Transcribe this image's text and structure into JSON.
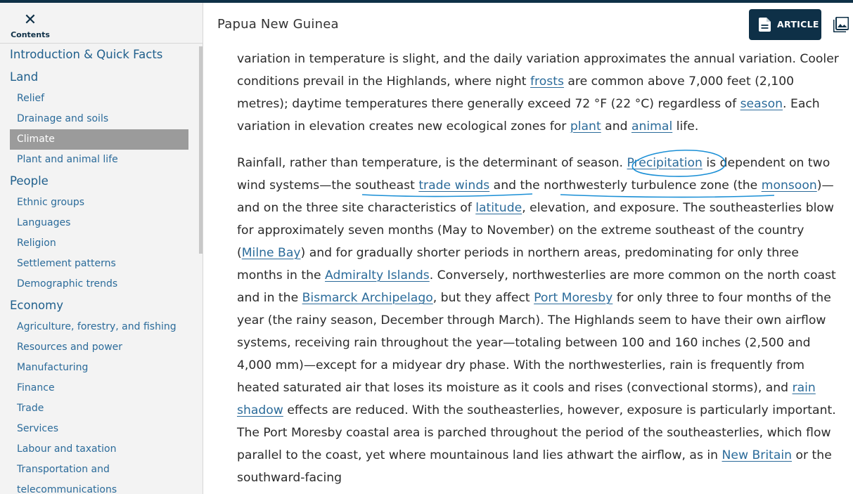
{
  "colors": {
    "brand_navy": "#0e3047",
    "link": "#2b6b9a",
    "active_bg": "#9b9b9b",
    "annotation": "#1a8fd6"
  },
  "sidebar": {
    "close_label": "Contents",
    "close_icon": "close-icon",
    "items": [
      {
        "type": "section",
        "label": "Introduction & Quick Facts"
      },
      {
        "type": "section",
        "label": "Land"
      },
      {
        "type": "sub",
        "label": "Relief"
      },
      {
        "type": "sub",
        "label": "Drainage and soils"
      },
      {
        "type": "sub",
        "label": "Climate",
        "active": true
      },
      {
        "type": "sub",
        "label": "Plant and animal life"
      },
      {
        "type": "section",
        "label": "People"
      },
      {
        "type": "sub",
        "label": "Ethnic groups"
      },
      {
        "type": "sub",
        "label": "Languages"
      },
      {
        "type": "sub",
        "label": "Religion"
      },
      {
        "type": "sub",
        "label": "Settlement patterns"
      },
      {
        "type": "sub",
        "label": "Demographic trends"
      },
      {
        "type": "section",
        "label": "Economy"
      },
      {
        "type": "sub",
        "label": "Agriculture, forestry, and fishing"
      },
      {
        "type": "sub",
        "label": "Resources and power"
      },
      {
        "type": "sub",
        "label": "Manufacturing"
      },
      {
        "type": "sub",
        "label": "Finance"
      },
      {
        "type": "sub",
        "label": "Trade"
      },
      {
        "type": "sub",
        "label": "Services"
      },
      {
        "type": "sub",
        "label": "Labour and taxation"
      },
      {
        "type": "sub",
        "label": "Transportation and telecommunications"
      }
    ]
  },
  "header": {
    "title": "Papua New Guinea",
    "article_label": "ARTICLE",
    "article_icon": "document-icon",
    "media_icon": "image-gallery-icon"
  },
  "article": {
    "p1": [
      {
        "t": "variation in temperature is slight, and the daily variation approximates the annual variation. Cooler conditions prevail in the Highlands, where night "
      },
      {
        "t": "frosts",
        "link": true
      },
      {
        "t": " are common above 7,000 feet (2,100 metres); daytime temperatures there generally exceed 72 °F (22 °C) regardless of "
      },
      {
        "t": "season",
        "link": true
      },
      {
        "t": ". Each variation in elevation creates new ecological zones for "
      },
      {
        "t": "plant",
        "link": true
      },
      {
        "t": " and "
      },
      {
        "t": "animal",
        "link": true
      },
      {
        "t": " life."
      }
    ],
    "p2": [
      {
        "t": "Rainfall, rather than temperature, is the determinant of season. "
      },
      {
        "t": "Precipitation",
        "link": true
      },
      {
        "t": " is dependent on two wind systems—the southeast "
      },
      {
        "t": "trade winds",
        "link": true
      },
      {
        "t": " and the northwesterly turbulence zone (the "
      },
      {
        "t": "monsoon",
        "link": true
      },
      {
        "t": ")—and on the three site characteristics of "
      },
      {
        "t": "latitude",
        "link": true
      },
      {
        "t": ", elevation, and exposure. The southeasterlies blow for approximately seven months (May to November) on the extreme southeast of the country ("
      },
      {
        "t": "Milne Bay",
        "link": true
      },
      {
        "t": ") and for gradually shorter periods in northern areas, predominating for only three months in the "
      },
      {
        "t": "Admiralty Islands",
        "link": true
      },
      {
        "t": ". Conversely, northwesterlies are more common on the north coast and in the "
      },
      {
        "t": "Bismarck Archipelago",
        "link": true
      },
      {
        "t": ", but they affect "
      },
      {
        "t": "Port Moresby",
        "link": true
      },
      {
        "t": " for only three to four months of the year (the rainy season, December through March). The Highlands seem to have their own airflow systems, receiving rain throughout the year—totaling between 100 and 160 inches (2,500 and 4,000 mm)—except for a midyear dry phase. With the northwesterlies, rain is frequently from heated saturated air that loses its moisture as it cools and rises (convectional storms), and "
      },
      {
        "t": "rain shadow",
        "link": true
      },
      {
        "t": " effects are reduced. With the southeasterlies, however, exposure is particularly important. The Port Moresby coastal area is parched throughout the period of the southeasterlies, which flow parallel to the coast, yet where mountainous land lies athwart the airflow, as in "
      },
      {
        "t": "New Britain",
        "link": true
      },
      {
        "t": " or the southward-facing"
      }
    ]
  }
}
